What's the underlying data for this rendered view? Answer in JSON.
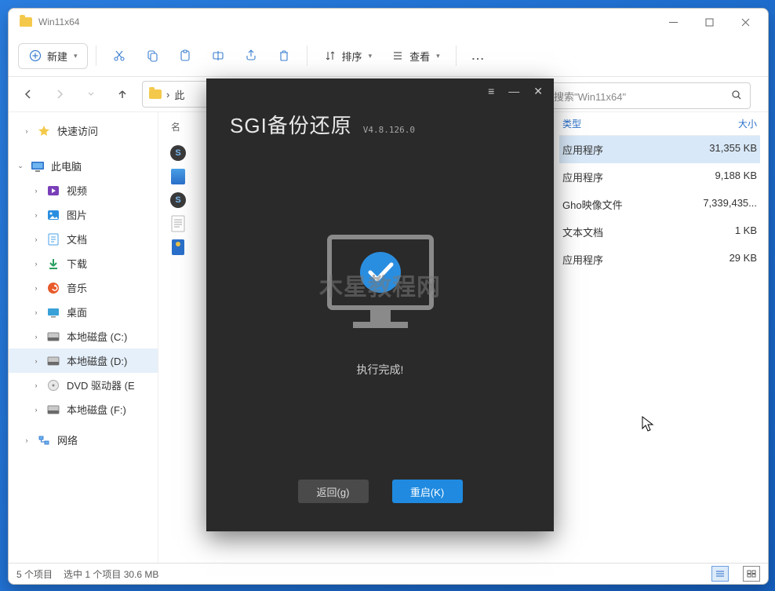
{
  "window": {
    "title": "Win11x64"
  },
  "toolbar": {
    "new": "新建",
    "sort": "排序",
    "view": "查看",
    "more": "..."
  },
  "address": {
    "prefix": "›",
    "segment": "此"
  },
  "search": {
    "placeholder": "搜索\"Win11x64\""
  },
  "sidebar": {
    "quick": "快速访问",
    "thispc": "此电脑",
    "items": [
      "视频",
      "图片",
      "文档",
      "下载",
      "音乐",
      "桌面",
      "本地磁盘 (C:)",
      "本地磁盘 (D:)",
      "DVD 驱动器 (E",
      "本地磁盘 (F:)"
    ],
    "network": "网络"
  },
  "filelist": {
    "name_header": "名"
  },
  "rightcols": {
    "headers": {
      "type": "类型",
      "size": "大小"
    },
    "rows": [
      {
        "type": "应用程序",
        "size": "31,355 KB",
        "sel": true
      },
      {
        "type": "应用程序",
        "size": "9,188 KB"
      },
      {
        "type": "Gho映像文件",
        "size": "7,339,435..."
      },
      {
        "type": "文本文档",
        "size": "1 KB"
      },
      {
        "type": "应用程序",
        "size": "29 KB"
      }
    ]
  },
  "status": {
    "count": "5 个项目",
    "selected": "选中 1 个项目 30.6 MB"
  },
  "dialog": {
    "brand": "SGI备份还原",
    "version": "V4.8.126.0",
    "watermark": "木星教程网",
    "done": "执行完成!",
    "back": "返回(g)",
    "restart": "重启(K)"
  }
}
